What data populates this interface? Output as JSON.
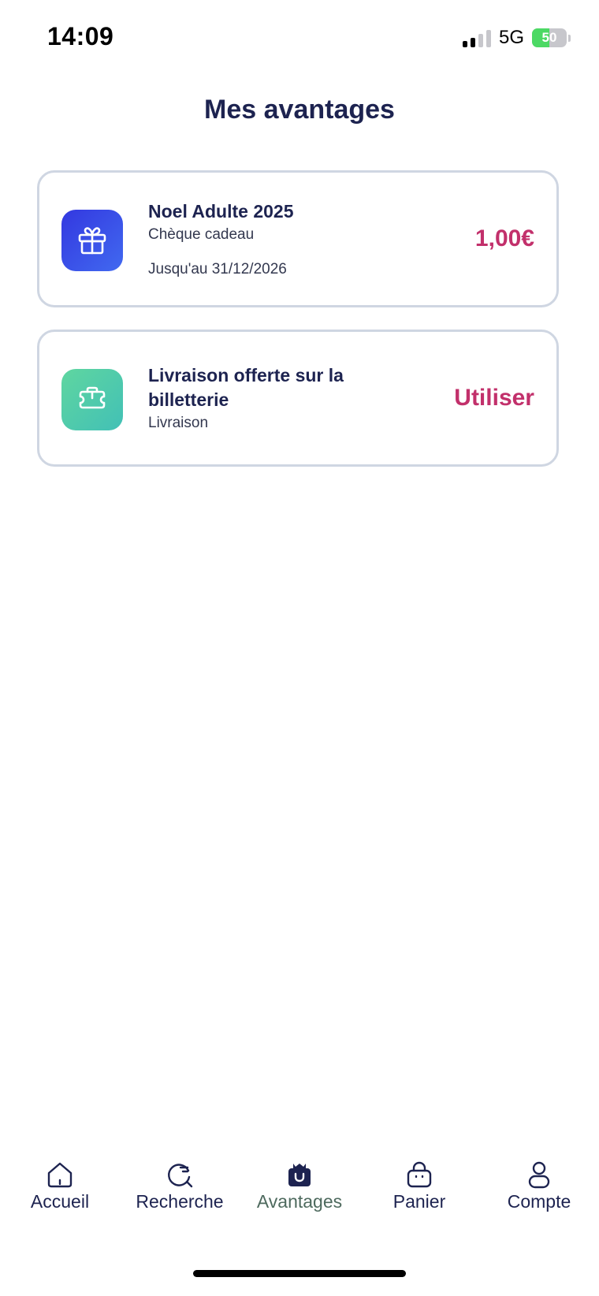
{
  "status_bar": {
    "time": "14:09",
    "network": "5G",
    "battery_level": "50",
    "battery_fraction": 0.5
  },
  "header": {
    "title": "Mes avantages"
  },
  "benefits": [
    {
      "icon": "gift-icon",
      "title": "Noel Adulte 2025",
      "type": "Chèque cadeau",
      "validity": "Jusqu'au 31/12/2026",
      "value": "1,00€"
    },
    {
      "icon": "ticket-icon",
      "title": "Livraison offerte sur la billetterie",
      "type": "Livraison",
      "action_label": "Utiliser"
    }
  ],
  "tab_bar": {
    "items": [
      {
        "label": "Accueil",
        "icon": "home-icon"
      },
      {
        "label": "Recherche",
        "icon": "search-icon"
      },
      {
        "label": "Avantages",
        "icon": "gift-icon",
        "active": true
      },
      {
        "label": "Panier",
        "icon": "bag-icon"
      },
      {
        "label": "Compte",
        "icon": "user-icon"
      }
    ]
  },
  "colors": {
    "primary_text": "#1d2350",
    "accent": "#c2306b",
    "active_tab": "#4e6a5e",
    "card_border": "#cfd6e2",
    "gift_icon_bg": "#3a4ee6",
    "delivery_icon_bg": "#4cc9ab"
  }
}
